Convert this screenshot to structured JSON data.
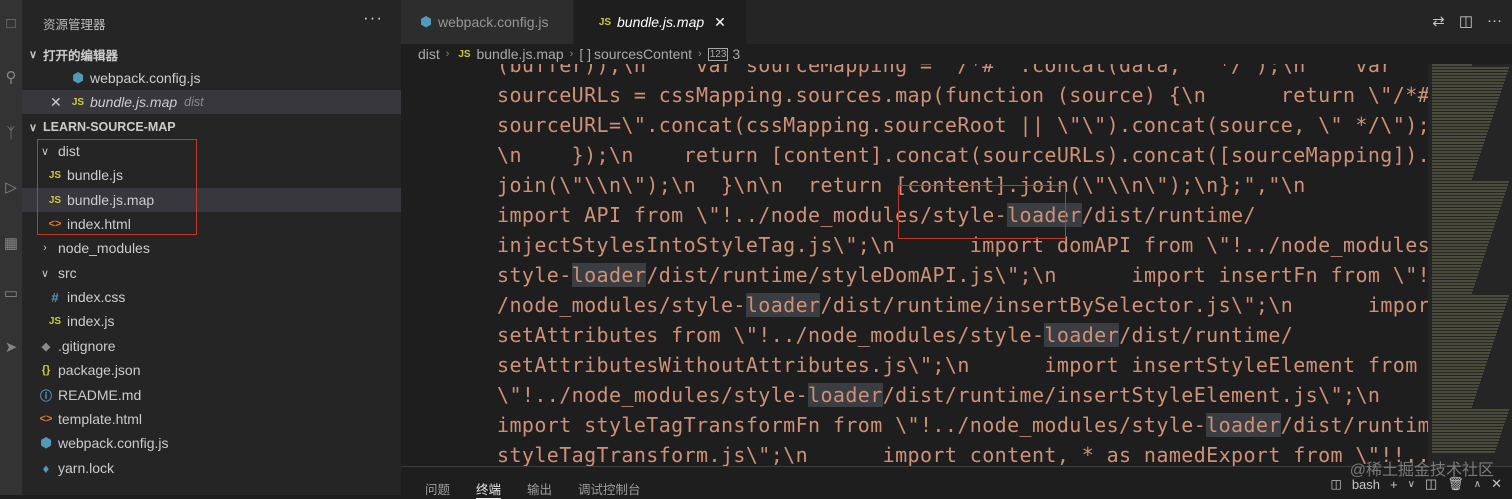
{
  "sidebar": {
    "title": "资源管理器",
    "more": "···",
    "open_editors": "打开的编辑器",
    "open_files": [
      {
        "name": "webpack.config.js",
        "icon": "webpack-icon"
      },
      {
        "name": "bundle.js.map",
        "dir": "dist",
        "icon": "js-icon"
      }
    ],
    "project": "LEARN-SOURCE-MAP",
    "tree": [
      {
        "name": "dist",
        "type": "folder-open"
      },
      {
        "name": "bundle.js",
        "type": "js"
      },
      {
        "name": "bundle.js.map",
        "type": "js"
      },
      {
        "name": "index.html",
        "type": "html"
      },
      {
        "name": "node_modules",
        "type": "folder"
      },
      {
        "name": "src",
        "type": "folder-open"
      },
      {
        "name": "index.css",
        "type": "css"
      },
      {
        "name": "index.js",
        "type": "js"
      },
      {
        "name": ".gitignore",
        "type": "git"
      },
      {
        "name": "package.json",
        "type": "json"
      },
      {
        "name": "README.md",
        "type": "info"
      },
      {
        "name": "template.html",
        "type": "html"
      },
      {
        "name": "webpack.config.js",
        "type": "webpack"
      },
      {
        "name": "yarn.lock",
        "type": "yarn"
      }
    ]
  },
  "tabs": [
    {
      "label": "webpack.config.js"
    },
    {
      "label": "bundle.js.map"
    }
  ],
  "breadcrumb": {
    "dist": "dist",
    "file": "bundle.js.map",
    "array_sym": "[ ]",
    "key": "sourcesContent",
    "index": "3"
  },
  "code": [
    "(buffer)),\\n    var sourceMapping = \"/*# \".concat(data, \" */\");\\n    var",
    "sourceURLs = cssMapping.sources.map(function (source) {\\n      return \\\"/*#",
    "sourceURL=\\\".concat(cssMapping.sourceRoot || \\\"\\\").concat(source, \\\" */\\\");",
    "\\n    });\\n    return [content].concat(sourceURLs).concat([sourceMapping]).",
    "join(\\\"\\\\n\\\");\\n  }\\n\\n  return [content].join(\\\"\\\\n\\\");\\n};\",\"\\n",
    "import API from \\\"!../node_modules/style-loader/dist/runtime/",
    "injectStylesIntoStyleTag.js\\\";\\n      import domAPI from \\\"!../node_modules/",
    "style-loader/dist/runtime/styleDomAPI.js\\\";\\n      import insertFn from \\\"!..",
    "/node_modules/style-loader/dist/runtime/insertBySelector.js\\\";\\n      import",
    "setAttributes from \\\"!../node_modules/style-loader/dist/runtime/",
    "setAttributesWithoutAttributes.js\\\";\\n      import insertStyleElement from",
    "\\\"!../node_modules/style-loader/dist/runtime/insertStyleElement.js\\\";\\n",
    "import styleTagTransformFn from \\\"!../node_modules/style-loader/dist/runtime/",
    "styleTagTransform.js\\\";\\n      import content, * as namedExport from \\\"!!../"
  ],
  "highlight_word": "loader",
  "panel": {
    "tabs": [
      "问题",
      "终端",
      "输出",
      "调试控制台"
    ],
    "active": "终端",
    "shell": "bash"
  },
  "watermark": "@稀土掘金技术社区"
}
